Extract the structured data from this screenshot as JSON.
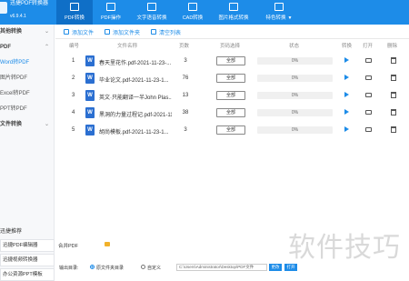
{
  "app": {
    "title": "迅捷PDF转换器",
    "version": "v6.9.4.1"
  },
  "nav": [
    {
      "label": "PDF转换",
      "active": true
    },
    {
      "label": "PDF操作"
    },
    {
      "label": "文字语音转换"
    },
    {
      "label": "CAD转换"
    },
    {
      "label": "图片格式转换"
    },
    {
      "label": "特色转换",
      "caret": "▼"
    }
  ],
  "sidebar": {
    "items": [
      {
        "label": "其他转换",
        "type": "group",
        "chev": "⌄"
      },
      {
        "label": "PDF",
        "type": "group",
        "chev": "⌃"
      },
      {
        "label": "Word转PDF",
        "type": "active"
      },
      {
        "label": "图片转PDF",
        "type": "sub"
      },
      {
        "label": "Excel转PDF",
        "type": "sub"
      },
      {
        "label": "PPT转PDF",
        "type": "sub"
      },
      {
        "label": "文件转换",
        "type": "group",
        "chev": "⌄"
      }
    ],
    "recommend_title": "迅捷推荐",
    "recommend": [
      "迅捷PDF编辑器",
      "迅捷视频转换器",
      "办公资源PPT模板"
    ]
  },
  "toolbar": {
    "add_file": "添加文件",
    "add_folder": "添加文件夹",
    "clear_list": "清空列表"
  },
  "table": {
    "headers": {
      "index": "编号",
      "name": "文件名称",
      "pages": "页数",
      "range": "页码选择",
      "status": "状态",
      "convert": "转换",
      "open": "打开",
      "delete": "删除"
    },
    "rows": [
      {
        "index": "1",
        "name": "春天里花作.pdf-2021-11-23-...",
        "pages": "3",
        "range": "全部",
        "progress": "0%"
      },
      {
        "index": "2",
        "name": "毕业论文.pdf-2021-11-23-1...",
        "pages": "76",
        "range": "全部",
        "progress": "0%"
      },
      {
        "index": "3",
        "name": "英文·只能翻译一半John Plas...",
        "pages": "13",
        "range": "全部",
        "progress": "0%"
      },
      {
        "index": "4",
        "name": "黑洞的力量过程记.pdf-2021-11...",
        "pages": "38",
        "range": "全部",
        "progress": "0%"
      },
      {
        "index": "5",
        "name": "胡尚模板.pdf-2021-11-23-1...",
        "pages": "3",
        "range": "全部",
        "progress": "0%"
      }
    ],
    "file_icon_letter": "W"
  },
  "bottom": {
    "merge_label": "合并PDF"
  },
  "output": {
    "label": "输出目录:",
    "option_original": "原文件夹目录",
    "option_custom": "自定义",
    "path": "C:\\Users\\Administrator\\Desktop\\PDF文件",
    "btn_change": "更改",
    "btn_open": "打开"
  },
  "watermark": "软件技巧",
  "colors": {
    "accent": "#1d8ce8",
    "header": "#1d8ce8",
    "word_icon": "#2b6fd1"
  }
}
